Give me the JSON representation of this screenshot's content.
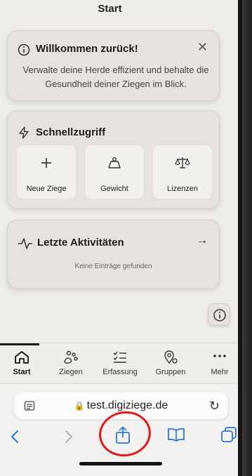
{
  "header": {
    "title": "Start"
  },
  "welcome": {
    "title": "Willkommen zurück!",
    "text": "Verwalte deine Herde effizient und behalte die Gesundheit deiner Ziegen im Blick."
  },
  "quick_access": {
    "title": "Schnellzugriff",
    "items": [
      {
        "label": "Neue Ziege",
        "icon": "plus-icon"
      },
      {
        "label": "Gewicht",
        "icon": "weight-icon"
      },
      {
        "label": "Lizenzen",
        "icon": "scale-icon"
      }
    ]
  },
  "activity": {
    "title": "Letzte Aktivitäten",
    "empty": "Keine Einträge gefunden"
  },
  "tabbar": {
    "tabs": [
      {
        "label": "Start",
        "icon": "home-icon",
        "active": true
      },
      {
        "label": "Ziegen",
        "icon": "goat-icon"
      },
      {
        "label": "Erfassung",
        "icon": "checklist-icon"
      },
      {
        "label": "Gruppen",
        "icon": "group-icon"
      },
      {
        "label": "Mehr",
        "icon": "more-icon"
      }
    ]
  },
  "browser": {
    "url": "test.digiziege.de",
    "annotation_color": "#e3181b"
  }
}
